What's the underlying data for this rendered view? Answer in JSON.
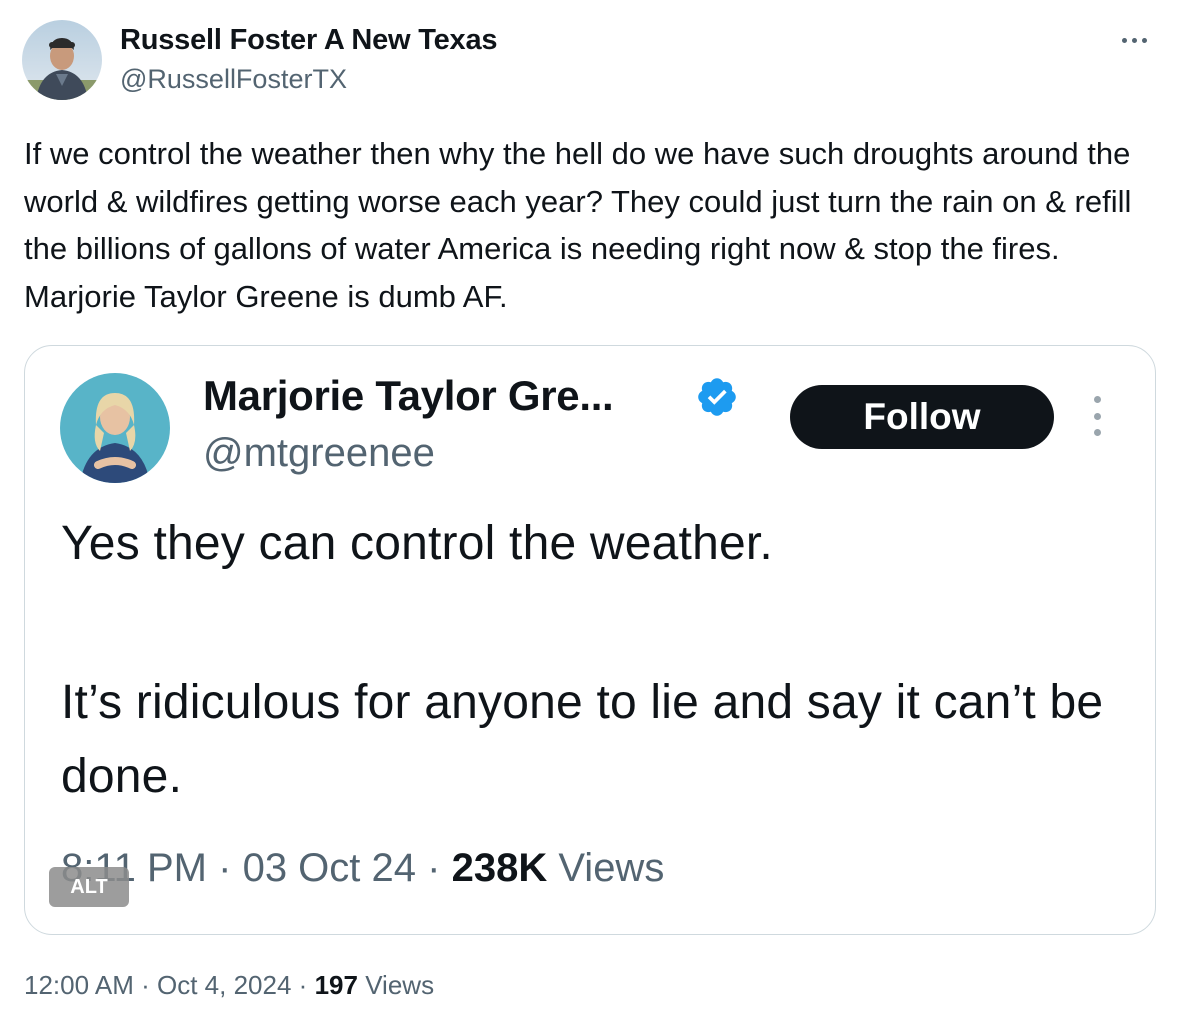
{
  "author": {
    "name": "Russell Foster A New Texas",
    "handle": "@RussellFosterTX"
  },
  "tweet": {
    "text": "If we control the weather then why the hell do we have such droughts around the world & wildfires getting worse each year? They could just turn the rain on & refill the billions of gallons of water America is needing right now & stop the fires. Marjorie Taylor Greene is dumb AF.",
    "time": "12:00 AM",
    "date": "Oct 4, 2024",
    "views_count": "197",
    "views_label": "Views",
    "separator": "·"
  },
  "media": {
    "alt_badge": "ALT",
    "quoted": {
      "name": "Marjorie Taylor Gre...",
      "handle": "@mtgreenee",
      "follow_label": "Follow",
      "text_line1": "Yes they can control the weather.",
      "text_line2": "It’s ridiculous for anyone to lie and say it can’t be done.",
      "time": "8:11 PM",
      "date": "03 Oct 24",
      "views_count": "238K",
      "views_label": "Views",
      "separator": "·"
    }
  },
  "colors": {
    "primary_text": "#0f1419",
    "secondary_text": "#536471",
    "border": "#cfd9de",
    "verified": "#1d9bf0"
  },
  "icons": [
    "more-icon",
    "verified-badge-icon",
    "more-vertical-icon"
  ]
}
